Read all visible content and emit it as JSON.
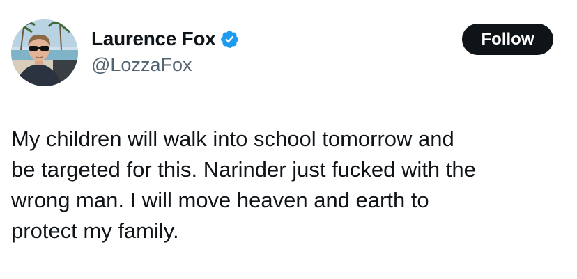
{
  "author": {
    "display_name": "Laurence Fox",
    "handle": "@LozzaFox",
    "verified": true,
    "avatar_icon": "profile-photo"
  },
  "follow_button": {
    "label": "Follow"
  },
  "tweet": {
    "lines": [
      "My children will walk into school tomorrow and",
      "be targeted for this. Narinder just fucked with the",
      "wrong man. I will move heaven and earth to",
      "protect my family."
    ]
  },
  "colors": {
    "text": "#0f1419",
    "secondary_text": "#536471",
    "verified_badge": "#1d9bf0",
    "follow_button_bg": "#0f1419"
  }
}
